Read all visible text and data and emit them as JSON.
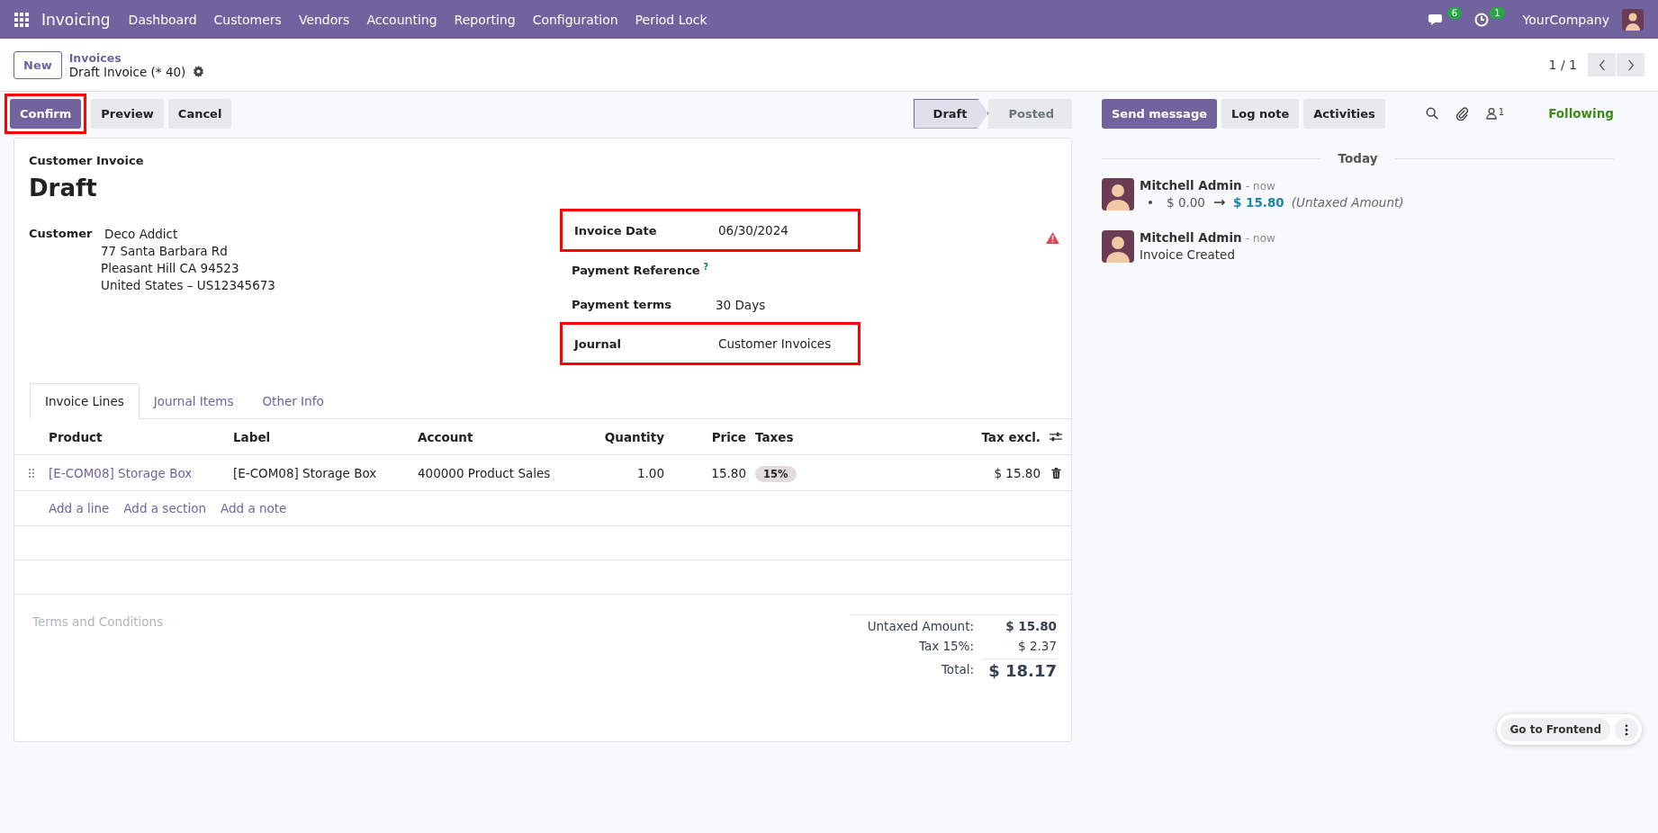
{
  "navbar": {
    "app_name": "Invoicing",
    "menu": [
      "Dashboard",
      "Customers",
      "Vendors",
      "Accounting",
      "Reporting",
      "Configuration",
      "Period Lock"
    ],
    "messages_badge": "6",
    "activities_badge": "1",
    "company": "YourCompany"
  },
  "control_panel": {
    "new_button": "New",
    "breadcrumb": "Invoices",
    "record": "Draft Invoice (* 40)",
    "pager": "1 / 1"
  },
  "actions": [
    {
      "label": "Confirm",
      "kind": "primary",
      "highlighted": true
    },
    {
      "label": "Preview",
      "kind": "secondary",
      "highlighted": false
    },
    {
      "label": "Cancel",
      "kind": "secondary",
      "highlighted": false
    }
  ],
  "status_steps": [
    {
      "label": "Draft",
      "selected": true
    },
    {
      "label": "Posted",
      "selected": false
    }
  ],
  "form": {
    "type_label": "Customer Invoice",
    "title": "Draft",
    "customer": {
      "label": "Customer",
      "name": "Deco Addict",
      "address": [
        "77 Santa Barbara Rd",
        "Pleasant Hill CA 94523",
        "United States – US12345673"
      ]
    },
    "fields": [
      {
        "label": "Invoice Date",
        "value": "06/30/2024",
        "highlighted": true
      },
      {
        "label": "Payment Reference",
        "help": "?",
        "highlighted": false
      },
      {
        "label": "Payment terms",
        "value": "30 Days",
        "highlighted": false
      },
      {
        "label": "Journal",
        "value": "Customer Invoices",
        "highlighted": true
      }
    ],
    "tabs": [
      {
        "label": "Invoice Lines",
        "selected": true
      },
      {
        "label": "Journal Items",
        "selected": false
      },
      {
        "label": "Other Info",
        "selected": false
      }
    ],
    "table": {
      "columns": [
        "Product",
        "Label",
        "Account",
        "Quantity",
        "Price",
        "Taxes",
        "Tax excl."
      ],
      "rows": [
        {
          "product": "[E-COM08] Storage Box",
          "label": "[E-COM08] Storage Box",
          "account": "400000 Product Sales",
          "quantity": "1.00",
          "price": "15.80",
          "taxes": [
            "15%"
          ],
          "subtotal": "$ 15.80"
        }
      ],
      "add_links": [
        "Add a line",
        "Add a section",
        "Add a note"
      ]
    },
    "terms_placeholder": "Terms and Conditions",
    "totals": [
      {
        "label": "Untaxed Amount:",
        "value": "$ 15.80",
        "kind": "subtotal"
      },
      {
        "label": "Tax 15%:",
        "value": "$ 2.37",
        "kind": "tax"
      },
      {
        "label": "Total:",
        "value": "$ 18.17",
        "kind": "total"
      }
    ]
  },
  "chatter": {
    "buttons": [
      {
        "label": "Send message",
        "kind": "primary"
      },
      {
        "label": "Log note",
        "kind": "secondary"
      },
      {
        "label": "Activities",
        "kind": "secondary"
      }
    ],
    "followers_count": "1",
    "follow_status": "Following",
    "date_separator": "Today",
    "messages": [
      {
        "author": "Mitchell Admin",
        "time": "- now",
        "kind": "tracking",
        "old_value": "$ 0.00",
        "new_value": "$ 15.80",
        "field": "(Untaxed Amount)"
      },
      {
        "author": "Mitchell Admin",
        "time": "- now",
        "kind": "text",
        "body": "Invoice Created"
      }
    ]
  },
  "floating": {
    "button": "Go to Frontend"
  }
}
